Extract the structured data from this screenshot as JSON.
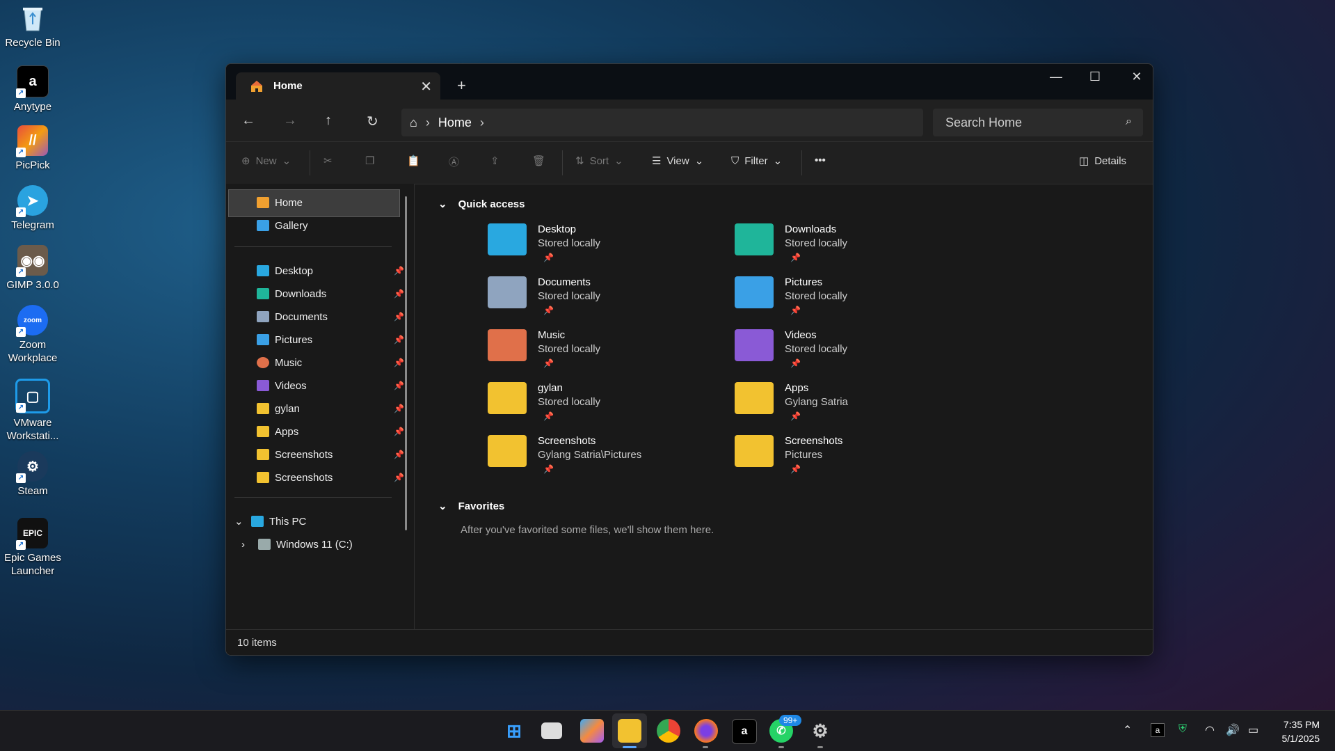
{
  "desktop": {
    "icons": [
      {
        "label": "Recycle Bin"
      },
      {
        "label": "Anytype"
      },
      {
        "label": "PicPick"
      },
      {
        "label": "Telegram"
      },
      {
        "label": "GIMP 3.0.0"
      },
      {
        "label": "Zoom Workplace"
      },
      {
        "label": "VMware Workstati..."
      },
      {
        "label": "Steam"
      },
      {
        "label": "Epic Games Launcher"
      }
    ]
  },
  "window": {
    "tab_title": "Home",
    "address": {
      "home_crumb": "Home"
    },
    "search_placeholder": "Search Home",
    "toolbar": {
      "new": "New",
      "sort": "Sort",
      "view": "View",
      "filter": "Filter",
      "more": "•••",
      "details": "Details"
    },
    "sidebar": {
      "top": [
        {
          "label": "Home"
        },
        {
          "label": "Gallery"
        }
      ],
      "pinned": [
        {
          "label": "Desktop"
        },
        {
          "label": "Downloads"
        },
        {
          "label": "Documents"
        },
        {
          "label": "Pictures"
        },
        {
          "label": "Music"
        },
        {
          "label": "Videos"
        },
        {
          "label": "gylan"
        },
        {
          "label": "Apps"
        },
        {
          "label": "Screenshots"
        },
        {
          "label": "Screenshots"
        }
      ],
      "this_pc": "This PC",
      "drive": "Windows 11 (C:)"
    },
    "quick_access": {
      "heading": "Quick access",
      "items": [
        {
          "name": "Desktop",
          "sub": "Stored locally",
          "color": "#29a8e0"
        },
        {
          "name": "Downloads",
          "sub": "Stored locally",
          "color": "#1fb59a"
        },
        {
          "name": "Documents",
          "sub": "Stored locally",
          "color": "#8fa4bf"
        },
        {
          "name": "Pictures",
          "sub": "Stored locally",
          "color": "#3aa0e6"
        },
        {
          "name": "Music",
          "sub": "Stored locally",
          "color": "#e0704a"
        },
        {
          "name": "Videos",
          "sub": "Stored locally",
          "color": "#8a5ad6"
        },
        {
          "name": "gylan",
          "sub": "Stored locally",
          "color": "#f2c230"
        },
        {
          "name": "Apps",
          "sub": "Gylang Satria",
          "color": "#f2c230"
        },
        {
          "name": "Screenshots",
          "sub": "Gylang Satria\\Pictures",
          "color": "#f2c230"
        },
        {
          "name": "Screenshots",
          "sub": "Pictures",
          "color": "#f2c230"
        }
      ]
    },
    "favorites": {
      "heading": "Favorites",
      "empty_message": "After you've favorited some files, we'll show them here."
    },
    "status": "10 items"
  },
  "taskbar": {
    "badge": "99+",
    "time": "7:35 PM",
    "date": "5/1/2025"
  }
}
